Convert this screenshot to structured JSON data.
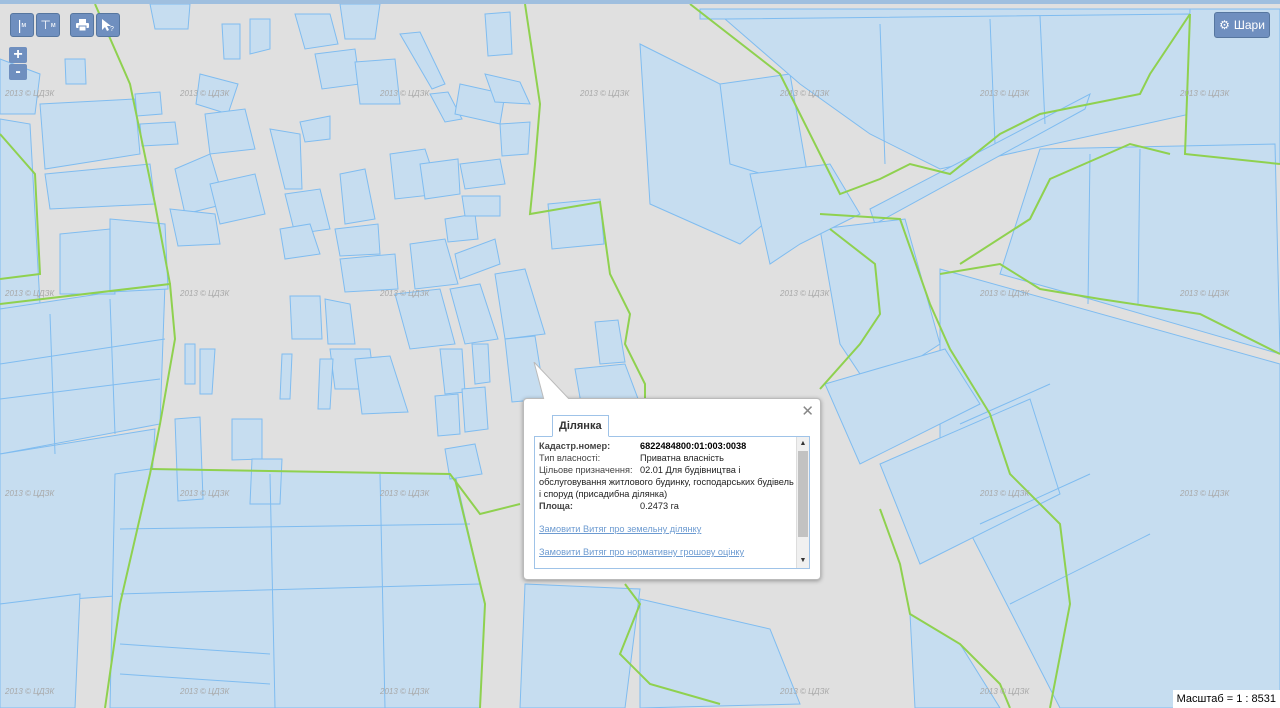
{
  "toolbar": {
    "measure_line_label": "м",
    "measure_area_label": "м",
    "print_icon": "printer-icon",
    "identify_icon": "cursor-question-icon"
  },
  "zoom": {
    "in_label": "+",
    "out_label": "-"
  },
  "layers_button": {
    "label": "Шари",
    "icon": "gear-icon"
  },
  "watermark": "2013 © ЦДЗК",
  "scale": {
    "label": "Масштаб = 1 : 8531"
  },
  "colors": {
    "background": "#e0e0e0",
    "parcel_fill": "#c6ddf0",
    "parcel_stroke": "#7fbcf0",
    "boundary": "#8fd14f",
    "button": "#6f8fbf"
  },
  "popup": {
    "tab": "Ділянка",
    "fields": [
      {
        "label": "Кадастр.номер:",
        "value": "6822484800:01:003:0038"
      },
      {
        "label": "Тип власності:",
        "value": "Приватна власність"
      },
      {
        "label": "Цільове призначення:",
        "value": "02.01 Для будівництва і обслуговування житлового будинку, господарських будівель і споруд (присадибна ділянка)"
      },
      {
        "label": "Площа:",
        "value": "0.2473 га"
      }
    ],
    "links": [
      "Замовити Витяг про земельну ділянку",
      "Замовити Витяг про нормативну грошову оцінку"
    ]
  }
}
